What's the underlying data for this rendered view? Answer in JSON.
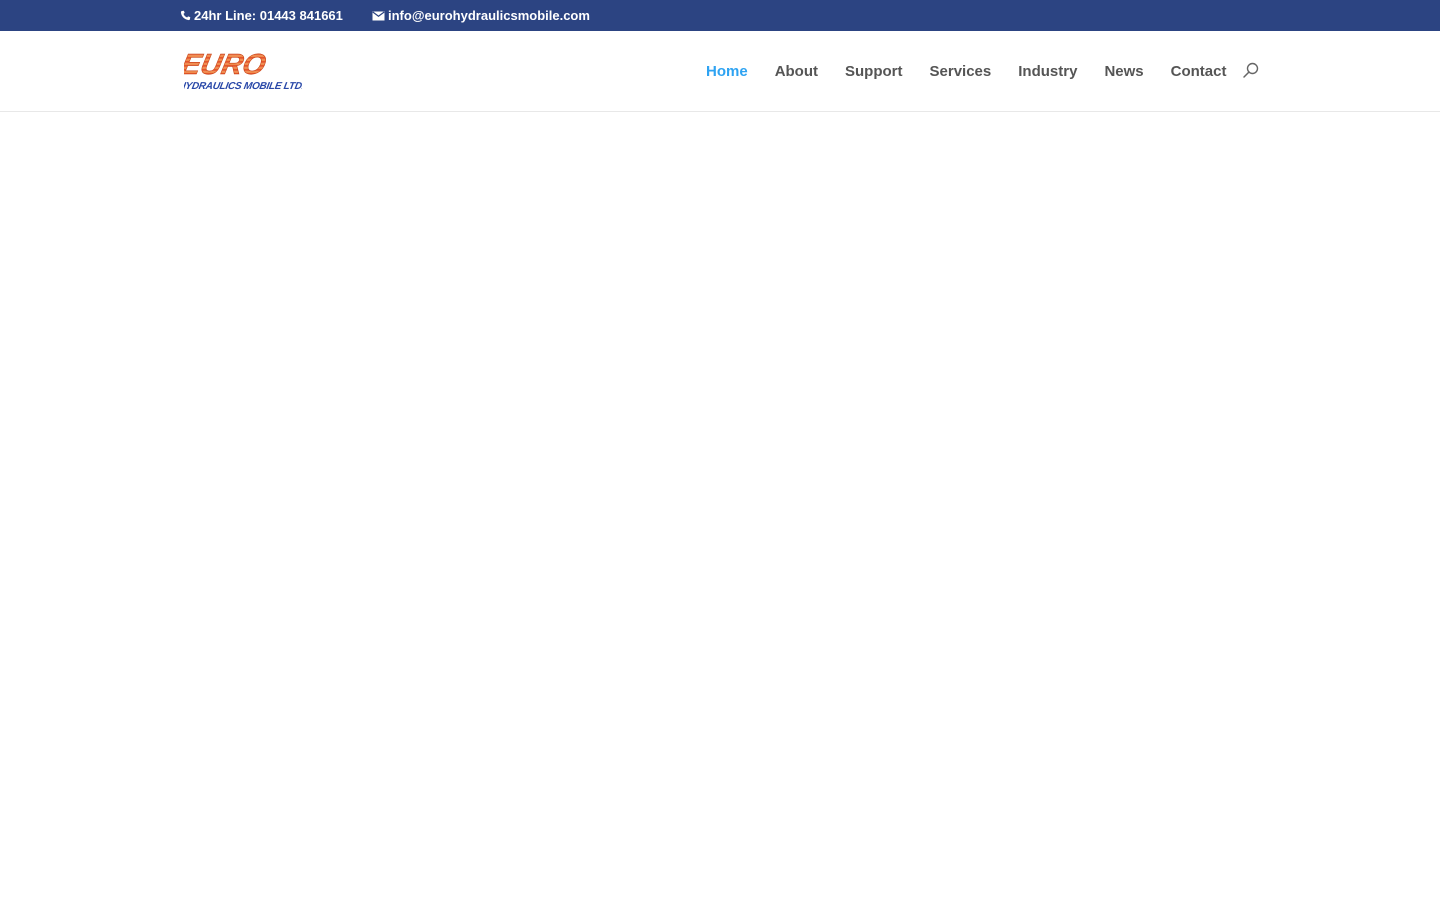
{
  "topbar": {
    "phone_icon": "phone-icon",
    "phone_text": "24hr Line: 01443 841661",
    "email_icon": "envelope-icon",
    "email_text": "info@eurohydraulicsmobile.com"
  },
  "header": {
    "logo": {
      "wordmark": "EURO",
      "subtitle": "HYDRAULICS MOBILE LTD."
    },
    "nav": [
      {
        "label": "Home",
        "active": true
      },
      {
        "label": "About",
        "active": false
      },
      {
        "label": "Support",
        "active": false
      },
      {
        "label": "Services",
        "active": false
      },
      {
        "label": "Industry",
        "active": false
      },
      {
        "label": "News",
        "active": false
      },
      {
        "label": "Contact",
        "active": false
      }
    ],
    "search_icon": "search-icon"
  },
  "colors": {
    "topbar_background": "#2c4482",
    "active_nav": "#2ea3f2",
    "nav_text": "#555555",
    "logo_orange": "#e5562b",
    "logo_blue": "#2847a8"
  }
}
